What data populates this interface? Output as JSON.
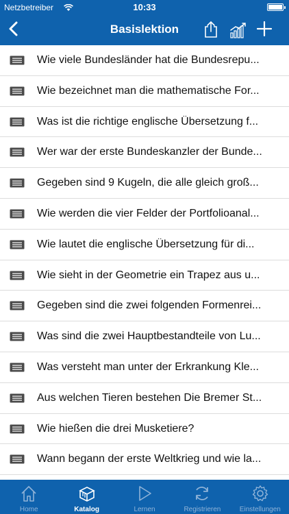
{
  "status_bar": {
    "carrier": "Netzbetreiber",
    "time": "10:33"
  },
  "nav": {
    "title": "Basislektion"
  },
  "questions": [
    "Wie viele Bundesländer hat die Bundesrepu...",
    "Wie bezeichnet man die mathematische For...",
    "Was ist die richtige englische Übersetzung f...",
    "Wer war der erste Bundeskanzler der Bunde...",
    "Gegeben sind 9 Kugeln, die alle gleich groß...",
    "Wie werden die vier Felder der Portfolioanal...",
    "Wie lautet die englische Übersetzung für di...",
    "Wie sieht in der Geometrie ein Trapez aus u...",
    "Gegeben sind die zwei folgenden Formenrei...",
    "Was sind die zwei Hauptbestandteile von Lu...",
    "Was versteht man unter der Erkrankung Kle...",
    "Aus welchen Tieren bestehen Die Bremer St...",
    "Wie hießen die drei Musketiere?",
    "Wann begann der erste Weltkrieg und wie la..."
  ],
  "tabs": [
    {
      "label": "Home",
      "icon": "home-icon",
      "active": false
    },
    {
      "label": "Katalog",
      "icon": "catalog-icon",
      "active": true
    },
    {
      "label": "Lernen",
      "icon": "play-icon",
      "active": false
    },
    {
      "label": "Registrieren",
      "icon": "refresh-icon",
      "active": false
    },
    {
      "label": "Einstellungen",
      "icon": "gear-icon",
      "active": false
    }
  ],
  "colors": {
    "accent": "#0f62ad",
    "tab_inactive": "#8fb3d8"
  }
}
